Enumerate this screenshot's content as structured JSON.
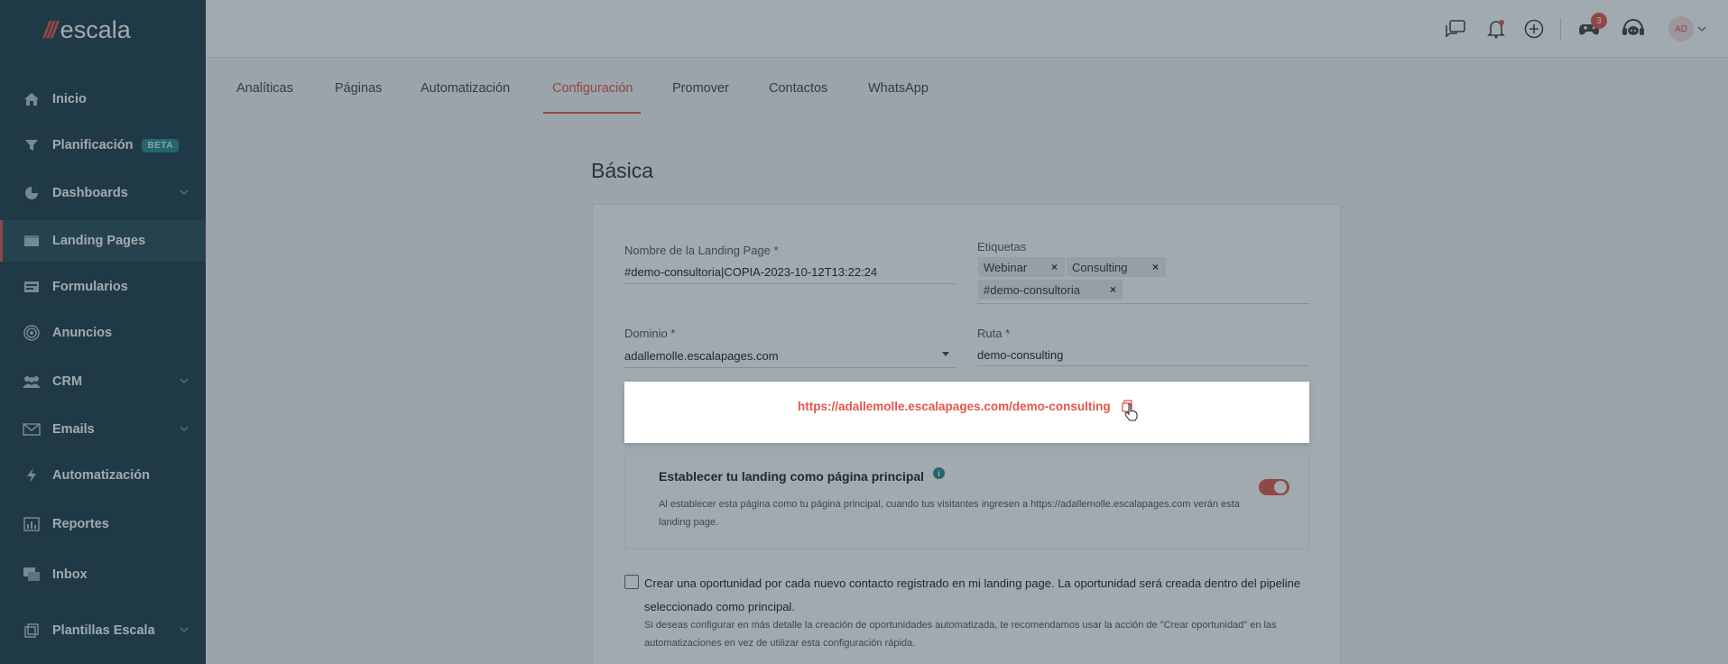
{
  "brand": {
    "name": "escala",
    "accent": "#e2574c",
    "sidebar_bg": "#1f3e4b",
    "teal": "#2a8a8f"
  },
  "sidebar": {
    "items": [
      {
        "label": "Inicio",
        "icon": "home-icon"
      },
      {
        "label": "Planificación",
        "icon": "filter-icon",
        "badge": "BETA"
      },
      {
        "label": "Dashboards",
        "icon": "pie-chart-icon",
        "expandable": true
      },
      {
        "label": "Landing Pages",
        "icon": "landing-page-icon",
        "active": true
      },
      {
        "label": "Formularios",
        "icon": "form-icon"
      },
      {
        "label": "Anuncios",
        "icon": "target-icon"
      },
      {
        "label": "CRM",
        "icon": "users-icon",
        "expandable": true
      },
      {
        "label": "Emails",
        "icon": "mail-icon",
        "expandable": true
      },
      {
        "label": "Automatización",
        "icon": "lightning-icon"
      },
      {
        "label": "Reportes",
        "icon": "bar-chart-icon"
      },
      {
        "label": "Inbox",
        "icon": "chat-icon"
      },
      {
        "label": "Plantillas Escala",
        "icon": "template-icon",
        "expandable": true
      }
    ]
  },
  "header": {
    "notification_count": "3",
    "avatar_initials": "AD",
    "icons": [
      "feedback-icon",
      "bell-icon",
      "plus-circle-icon",
      "game-controller-icon",
      "support-icon",
      "avatar-chevron-icon"
    ]
  },
  "tabs": [
    {
      "label": "Analíticas"
    },
    {
      "label": "Páginas"
    },
    {
      "label": "Automatización"
    },
    {
      "label": "Configuración",
      "active": true
    },
    {
      "label": "Promover"
    },
    {
      "label": "Contactos"
    },
    {
      "label": "WhatsApp"
    }
  ],
  "section": {
    "title": "Básica"
  },
  "form": {
    "name_label": "Nombre de la Landing Page *",
    "name_value": "#demo-consultoria|COPIA-2023-10-12T13:22:24",
    "tags_label": "Etiquetas",
    "tags": [
      "Webinar",
      "Consulting",
      "#demo-consultoria"
    ],
    "domain_label": "Dominio *",
    "domain_value": "adallemolle.escalapages.com",
    "route_label": "Ruta *",
    "route_value": "demo-consulting",
    "url": "https://adallemolle.escalapages.com/demo-consulting"
  },
  "main_page": {
    "title": "Establecer tu landing como página principal",
    "description": "Al establecer esta página como tu página principal, cuando tus visitantes ingresen a https://adallemolle.escalapages.com verán esta landing page.",
    "enabled": true
  },
  "opportunity": {
    "label": "Crear una oportunidad por cada nuevo contacto registrado en mi landing page. La oportunidad será creada dentro del pipeline seleccionado como principal.",
    "note": "Si deseas configurar en más detalle la creación de oportunidades automatizada, te recomendamos usar la acción de \"Crear oportunidad\" en las automatizaciones en vez de utilizar esta configuración rápida.",
    "checked": false
  }
}
